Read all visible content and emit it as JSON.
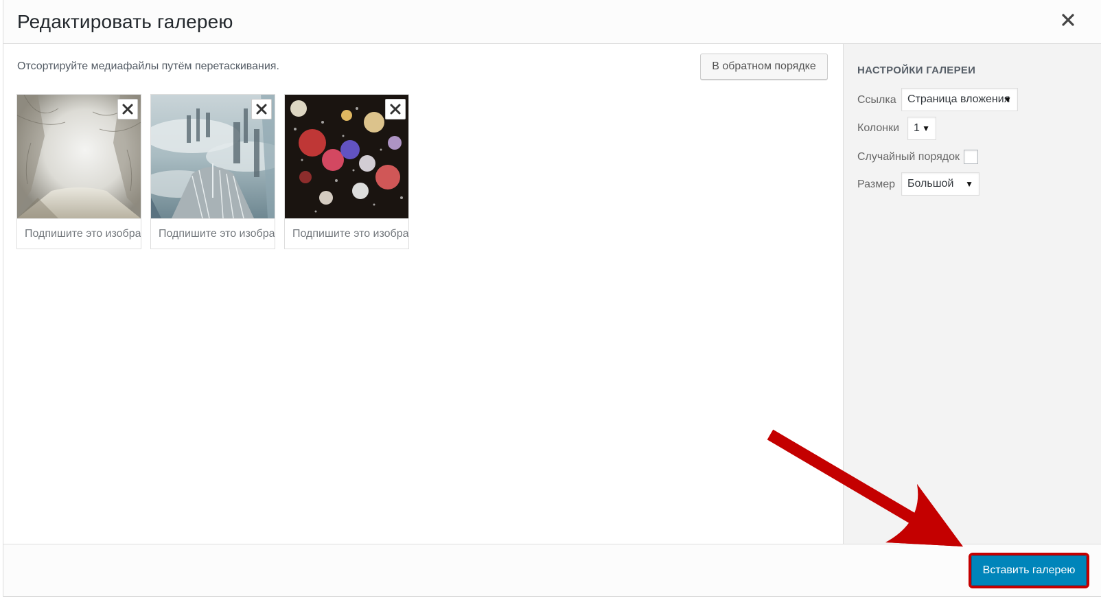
{
  "modal": {
    "title": "Редактировать галерею",
    "close_icon": "close-icon"
  },
  "main": {
    "instructions": "Отсортируйте медиафайлы путём перетаскивания.",
    "reverse_button": "В обратном порядке",
    "thumbnails": [
      {
        "image": "snowy-forest-road",
        "caption_placeholder": "Подпишите это изобра",
        "remove_icon": "close-icon"
      },
      {
        "image": "skyscrapers-above-clouds",
        "caption_placeholder": "Подпишите это изобра",
        "remove_icon": "close-icon"
      },
      {
        "image": "bokeh-rain-drops",
        "caption_placeholder": "Подпишите это изобра",
        "remove_icon": "close-icon"
      }
    ]
  },
  "sidebar": {
    "heading": "Настройки галереи",
    "link_label": "Ссылка",
    "link_value": "Страница вложения",
    "columns_label": "Колонки",
    "columns_value": "1",
    "random_label": "Случайный порядок",
    "random_checked": false,
    "size_label": "Размер",
    "size_value": "Большой",
    "dropdown_icon": "triangle-down-icon"
  },
  "footer": {
    "insert_button": "Вставить галерею"
  },
  "colors": {
    "primary_button": "#0085ba",
    "annotation_red": "#c40000",
    "sidebar_bg": "#f3f3f3"
  }
}
